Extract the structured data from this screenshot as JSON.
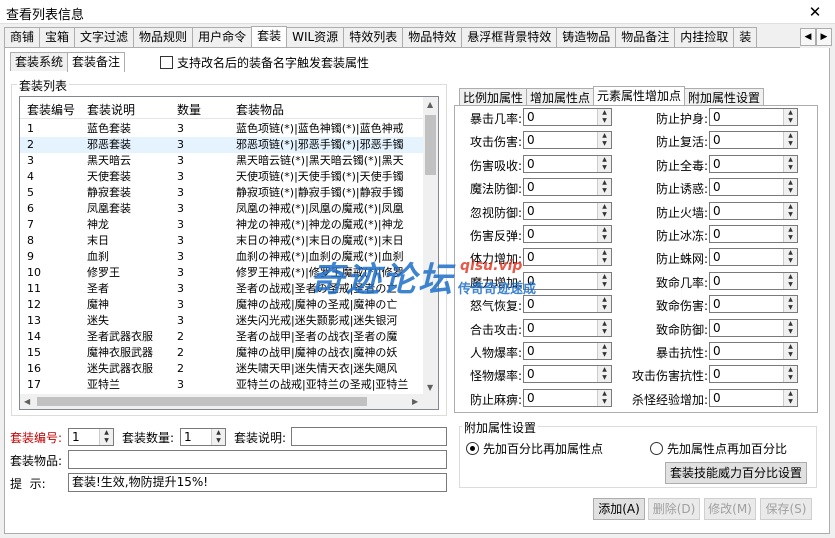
{
  "window": {
    "title": "查看列表信息",
    "close_glyph": "✕"
  },
  "main_tabs": [
    "商铺",
    "宝箱",
    "文字过滤",
    "物品规则",
    "用户命令",
    "套装",
    "WIL资源",
    "特效列表",
    "物品特效",
    "悬浮框背景特效",
    "铸造物品",
    "物品备注",
    "内挂捡取",
    "装"
  ],
  "sub_tabs": [
    "套装系统",
    "套装备注"
  ],
  "rename_checkbox": "支持改名后的装备名字触发套装属性",
  "list_group": "套装列表",
  "columns": [
    "套装编号",
    "套装说明",
    "数量",
    "套装物品"
  ],
  "rows": [
    [
      "1",
      "蓝色套装",
      "3",
      "蓝色项链(*)|蓝色神镯(*)|蓝色神戒"
    ],
    [
      "2",
      "邪恶套装",
      "3",
      "邪恶项链(*)|邪恶手镯(*)|邪恶手镯"
    ],
    [
      "3",
      "黑天暗云",
      "3",
      "黑天暗云链(*)|黑天暗云镯(*)|黑天"
    ],
    [
      "4",
      "天使套装",
      "3",
      "天使项链(*)|天使手镯(*)|天使手镯"
    ],
    [
      "5",
      "静寂套装",
      "3",
      "静寂项链(*)|静寂手镯(*)|静寂手镯"
    ],
    [
      "6",
      "凤凰套装",
      "3",
      "凤凰の神戒(*)|凤凰の魔戒(*)|凤凰"
    ],
    [
      "7",
      "神龙",
      "3",
      "神龙の神戒(*)|神龙の魔戒(*)|神龙"
    ],
    [
      "8",
      "末日",
      "3",
      "末日の神戒(*)|末日の魔戒(*)|末日"
    ],
    [
      "9",
      "血刹",
      "3",
      "血刹の神戒(*)|血刹の魔戒(*)|血刹"
    ],
    [
      "10",
      "修罗王",
      "3",
      "修罗王神戒(*)|修罗王魔戒(*)|修罗"
    ],
    [
      "11",
      "圣者",
      "3",
      "圣者の战戒|圣者の圣戒|圣者の亡"
    ],
    [
      "12",
      "魔神",
      "3",
      "魔神の战戒|魔神の圣戒|魔神の亡"
    ],
    [
      "13",
      "迷失",
      "3",
      "迷失闪光戒|迷失颢影戒|迷失银河"
    ],
    [
      "14",
      "圣者武器衣服",
      "2",
      "圣者の战甲|圣者の战衣|圣者の魔"
    ],
    [
      "15",
      "魔神衣服武器",
      "2",
      "魔神の战甲|魔神の战衣|魔神の妖"
    ],
    [
      "16",
      "迷失武器衣服",
      "2",
      "迷失啸天甲|迷失情天衣|迷失飓风"
    ],
    [
      "17",
      "亚特兰",
      "3",
      "亚特兰の战戒|亚特兰の圣戒|亚特兰"
    ]
  ],
  "right_tabs": [
    "比例加属性",
    "增加属性点",
    "元素属性增加点",
    "附加属性设置"
  ],
  "left_fields": [
    "暴击几率:",
    "攻击伤害:",
    "伤害吸收:",
    "魔法防御:",
    "忽视防御:",
    "伤害反弹:",
    "体力增加:",
    "魔力增加:",
    "怒气恢复:",
    "合击攻击:",
    "人物爆率:",
    "怪物爆率:",
    "防止麻痹:"
  ],
  "right_fields": [
    "防止护身:",
    "防止复活:",
    "防止全毒:",
    "防止诱惑:",
    "防止火墙:",
    "防止冰冻:",
    "防止蛛网:",
    "致命几率:",
    "致命伤害:",
    "致命防御:",
    "暴击抗性:",
    "攻击伤害抗性:",
    "杀怪经验增加:"
  ],
  "field_value": "0",
  "form": {
    "id_label": "套装编号:",
    "id_value": "1",
    "count_label": "套装数量:",
    "count_value": "1",
    "desc_label": "套装说明:",
    "desc_value": "",
    "items_label": "套装物品:",
    "items_value": "",
    "hint_label": "提  示:",
    "hint_value": "套装!生效,物防提升15%!"
  },
  "attr_group": "附加属性设置",
  "radio1": "先加百分比再加属性点",
  "radio2": "先加属性点再加百分比",
  "skill_button": "套装技能威力百分比设置",
  "buttons": {
    "add": "添加(A)",
    "delete": "删除(D)",
    "modify": "修改(M)",
    "save": "保存(S)"
  },
  "watermark": {
    "main": "奇迹论坛",
    "site": "qisu.vip",
    "slogan": "传奇奇迹速成"
  },
  "colors": {
    "id_label": "#c00000",
    "selected_row": "#e5f3ff",
    "watermark": "#1e6fc8"
  }
}
